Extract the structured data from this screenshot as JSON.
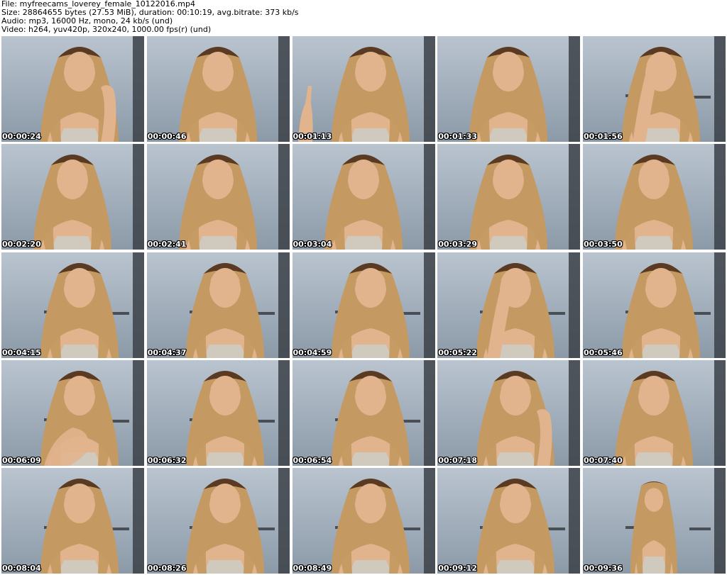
{
  "header": {
    "file_line": "File: myfreecams_loverey_female_10122016.mp4",
    "size_line": "Size: 28864655 bytes (27.53 MiB), duration: 00:10:19, avg.bitrate: 373 kb/s",
    "audio_line": "Audio: mp3, 16000 Hz, mono, 24 kb/s (und)",
    "video_line": "Video: h264, yuv420p, 320x240, 1000.00 fps(r) (und)"
  },
  "thumbnails": [
    {
      "time": "00:00:24",
      "pose": "hand-chin"
    },
    {
      "time": "00:00:46",
      "pose": "lean"
    },
    {
      "time": "00:01:13",
      "pose": "finger-up"
    },
    {
      "time": "00:01:33",
      "pose": "look-down"
    },
    {
      "time": "00:01:56",
      "pose": "hand-head"
    },
    {
      "time": "00:02:20",
      "pose": "lean"
    },
    {
      "time": "00:02:41",
      "pose": "lean"
    },
    {
      "time": "00:03:04",
      "pose": "lean"
    },
    {
      "time": "00:03:29",
      "pose": "lean"
    },
    {
      "time": "00:03:50",
      "pose": "lean"
    },
    {
      "time": "00:04:15",
      "pose": "shelf"
    },
    {
      "time": "00:04:37",
      "pose": "shelf"
    },
    {
      "time": "00:04:59",
      "pose": "shelf"
    },
    {
      "time": "00:05:22",
      "pose": "hand-head"
    },
    {
      "time": "00:05:46",
      "pose": "shelf"
    },
    {
      "time": "00:06:09",
      "pose": "hand-wave"
    },
    {
      "time": "00:06:32",
      "pose": "shelf"
    },
    {
      "time": "00:06:54",
      "pose": "shelf"
    },
    {
      "time": "00:07:18",
      "pose": "hand-chin"
    },
    {
      "time": "00:07:40",
      "pose": "look-down"
    },
    {
      "time": "00:08:04",
      "pose": "shelf"
    },
    {
      "time": "00:08:26",
      "pose": "shelf"
    },
    {
      "time": "00:08:49",
      "pose": "shelf"
    },
    {
      "time": "00:09:12",
      "pose": "shelf"
    },
    {
      "time": "00:09:36",
      "pose": "full-body"
    }
  ],
  "colors": {
    "wall": "#8c9aa8",
    "wall_light": "#b9c4cf",
    "hair": "#c49a62",
    "hair_dark": "#5a3a22",
    "skin": "#e2b48e",
    "top": "#cfc9be"
  }
}
